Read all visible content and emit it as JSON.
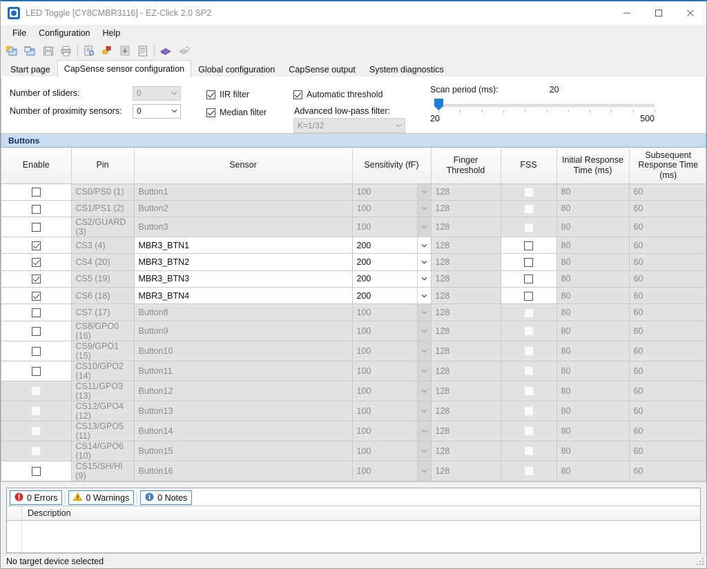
{
  "window": {
    "title": "LED Toggle [CY8CMBR3116] - EZ-Click 2.0 SP2",
    "app_icon": "ez-click-app-icon",
    "minimize": "—",
    "maximize": "□",
    "close": "✕"
  },
  "menu": [
    "File",
    "Configuration",
    "Help"
  ],
  "toolbar": [
    {
      "name": "new-project-icon",
      "enabled": true
    },
    {
      "name": "open-project-icon",
      "enabled": true
    },
    {
      "name": "save-icon",
      "enabled": false
    },
    {
      "name": "print-icon",
      "enabled": true
    },
    {
      "name": "configure-icon",
      "enabled": true
    },
    {
      "name": "apply-settings-icon",
      "enabled": true
    },
    {
      "name": "download-icon",
      "enabled": false
    },
    {
      "name": "report-icon",
      "enabled": true
    },
    {
      "name": "chip-icon",
      "enabled": true
    },
    {
      "name": "connect-icon",
      "enabled": false
    }
  ],
  "tabs": [
    {
      "label": "Start page",
      "active": false
    },
    {
      "label": "CapSense sensor configuration",
      "active": true
    },
    {
      "label": "Global configuration",
      "active": false
    },
    {
      "label": "CapSense output",
      "active": false
    },
    {
      "label": "System diagnostics",
      "active": false
    }
  ],
  "settings": {
    "sliders_label": "Number of sliders:",
    "sliders_value": "0",
    "sliders_enabled": false,
    "proximity_label": "Number of proximity sensors:",
    "proximity_value": "0",
    "proximity_enabled": true,
    "iir_filter": {
      "label": "IIR filter",
      "checked": true
    },
    "median_filter": {
      "label": "Median filter",
      "checked": true
    },
    "automatic_threshold": {
      "label": "Automatic threshold",
      "checked": true
    },
    "advanced_lpf_label": "Advanced low-pass filter:",
    "advanced_lpf_value": "K=1/32",
    "scan_period_label": "Scan period (ms):",
    "scan_period_value": "20",
    "scan_min": "20",
    "scan_max": "500",
    "slider_position_pct": 0
  },
  "group_header": "Buttons",
  "table": {
    "columns": [
      "Enable",
      "Pin",
      "Sensor",
      "Sensitivity (fF)",
      "Finger Threshold",
      "FSS",
      "Initial Response Time (ms)",
      "Subsequent Response Time (ms)"
    ],
    "rows": [
      {
        "enable": false,
        "enable_disabled": false,
        "pin": "CS0/PS0 (1)",
        "sensor": "Button1",
        "sensitivity": "100",
        "finger_threshold": "128",
        "fss": false,
        "initial": "80",
        "subsequent": "60",
        "row_enabled": false
      },
      {
        "enable": false,
        "enable_disabled": false,
        "pin": "CS1/PS1 (2)",
        "sensor": "Button2",
        "sensitivity": "100",
        "finger_threshold": "128",
        "fss": false,
        "initial": "80",
        "subsequent": "60",
        "row_enabled": false
      },
      {
        "enable": false,
        "enable_disabled": false,
        "pin": "CS2/GUARD (3)",
        "sensor": "Button3",
        "sensitivity": "100",
        "finger_threshold": "128",
        "fss": false,
        "initial": "80",
        "subsequent": "60",
        "row_enabled": false
      },
      {
        "enable": true,
        "enable_disabled": false,
        "pin": "CS3 (4)",
        "sensor": "MBR3_BTN1",
        "sensitivity": "200",
        "finger_threshold": "128",
        "fss": false,
        "initial": "80",
        "subsequent": "60",
        "row_enabled": true
      },
      {
        "enable": true,
        "enable_disabled": false,
        "pin": "CS4 (20)",
        "sensor": "MBR3_BTN2",
        "sensitivity": "200",
        "finger_threshold": "128",
        "fss": false,
        "initial": "80",
        "subsequent": "60",
        "row_enabled": true
      },
      {
        "enable": true,
        "enable_disabled": false,
        "pin": "CS5 (19)",
        "sensor": "MBR3_BTN3",
        "sensitivity": "200",
        "finger_threshold": "128",
        "fss": false,
        "initial": "80",
        "subsequent": "60",
        "row_enabled": true
      },
      {
        "enable": true,
        "enable_disabled": false,
        "pin": "CS6 (18)",
        "sensor": "MBR3_BTN4",
        "sensitivity": "200",
        "finger_threshold": "128",
        "fss": false,
        "initial": "80",
        "subsequent": "60",
        "row_enabled": true
      },
      {
        "enable": false,
        "enable_disabled": false,
        "pin": "CS7 (17)",
        "sensor": "Button8",
        "sensitivity": "100",
        "finger_threshold": "128",
        "fss": false,
        "initial": "80",
        "subsequent": "60",
        "row_enabled": false
      },
      {
        "enable": false,
        "enable_disabled": false,
        "pin": "CS8/GPO0 (16)",
        "sensor": "Button9",
        "sensitivity": "100",
        "finger_threshold": "128",
        "fss": false,
        "initial": "80",
        "subsequent": "60",
        "row_enabled": false
      },
      {
        "enable": false,
        "enable_disabled": false,
        "pin": "CS9/GPO1 (15)",
        "sensor": "Button10",
        "sensitivity": "100",
        "finger_threshold": "128",
        "fss": false,
        "initial": "80",
        "subsequent": "60",
        "row_enabled": false
      },
      {
        "enable": false,
        "enable_disabled": false,
        "pin": "CS10/GPO2 (14)",
        "sensor": "Button11",
        "sensitivity": "100",
        "finger_threshold": "128",
        "fss": false,
        "initial": "80",
        "subsequent": "60",
        "row_enabled": false
      },
      {
        "enable": false,
        "enable_disabled": true,
        "pin": "CS11/GPO3 (13)",
        "sensor": "Button12",
        "sensitivity": "100",
        "finger_threshold": "128",
        "fss": false,
        "initial": "80",
        "subsequent": "60",
        "row_enabled": false
      },
      {
        "enable": false,
        "enable_disabled": true,
        "pin": "CS12/GPO4 (12)",
        "sensor": "Button13",
        "sensitivity": "100",
        "finger_threshold": "128",
        "fss": false,
        "initial": "80",
        "subsequent": "60",
        "row_enabled": false
      },
      {
        "enable": false,
        "enable_disabled": true,
        "pin": "CS13/GPO5 (11)",
        "sensor": "Button14",
        "sensitivity": "100",
        "finger_threshold": "128",
        "fss": false,
        "initial": "80",
        "subsequent": "60",
        "row_enabled": false
      },
      {
        "enable": false,
        "enable_disabled": true,
        "pin": "CS14/GPO6 (10)",
        "sensor": "Button15",
        "sensitivity": "100",
        "finger_threshold": "128",
        "fss": false,
        "initial": "80",
        "subsequent": "60",
        "row_enabled": false
      },
      {
        "enable": false,
        "enable_disabled": false,
        "pin": "CS15/SH/HI (9)",
        "sensor": "Button16",
        "sensitivity": "100",
        "finger_threshold": "128",
        "fss": false,
        "initial": "80",
        "subsequent": "60",
        "row_enabled": false
      }
    ]
  },
  "messages": {
    "errors": "0 Errors",
    "warnings": "0 Warnings",
    "notes": "0 Notes",
    "description_header": "Description",
    "items": []
  },
  "statusbar": {
    "text": "No target device selected"
  },
  "colors": {
    "accent": "#1a7fd4",
    "group_header_bg": "#c9dcf0",
    "error": "#d32f2f",
    "warning": "#f5c518",
    "note": "#4a7fb5",
    "disabled_text": "#8a8a8a"
  }
}
